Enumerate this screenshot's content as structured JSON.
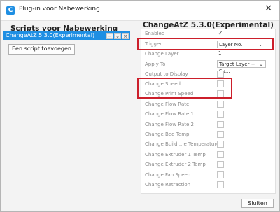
{
  "window": {
    "title": "Plug-in voor Nabewerking",
    "app_icon": "C"
  },
  "left": {
    "title": "Scripts voor Nabewerking",
    "scripts": [
      {
        "label": "ChangeAtZ 5.3.0(Experimental)"
      }
    ],
    "script_tools": [
      "−",
      "⌄",
      "×"
    ],
    "add_button": "Een script toevoegen"
  },
  "right": {
    "title": "ChangeAtZ 5.3.0(Experimental)",
    "settings": {
      "enabled": "Enabled",
      "trigger": "Trigger",
      "change_layer": "Change Layer",
      "apply_to": "Apply To",
      "output_to_display": "Output to Display",
      "change_speed": "Change Speed",
      "change_print_speed": "Change Print Speed",
      "change_flow_rate": "Change Flow Rate",
      "change_flow_rate_1": "Change Flow Rate 1",
      "change_flow_rate_2": "Change Flow Rate 2",
      "change_bed_temp": "Change Bed Temp",
      "change_build_temp": "Change Build ...e Temperature",
      "change_extruder_1_temp": "Change Extruder 1 Temp",
      "change_extruder_2_temp": "Change Extruder 2 Temp",
      "change_fan_speed": "Change Fan Speed",
      "change_retraction": "Change Retraction"
    },
    "values": {
      "enabled_check": "✓",
      "trigger": "Layer No.",
      "change_layer": "1",
      "apply_to": "Target Layer + Su..."
    }
  },
  "footer": {
    "close_button": "Sluiten"
  },
  "colors": {
    "accent": "#1f8fe3",
    "highlight": "#cc1f2b"
  }
}
